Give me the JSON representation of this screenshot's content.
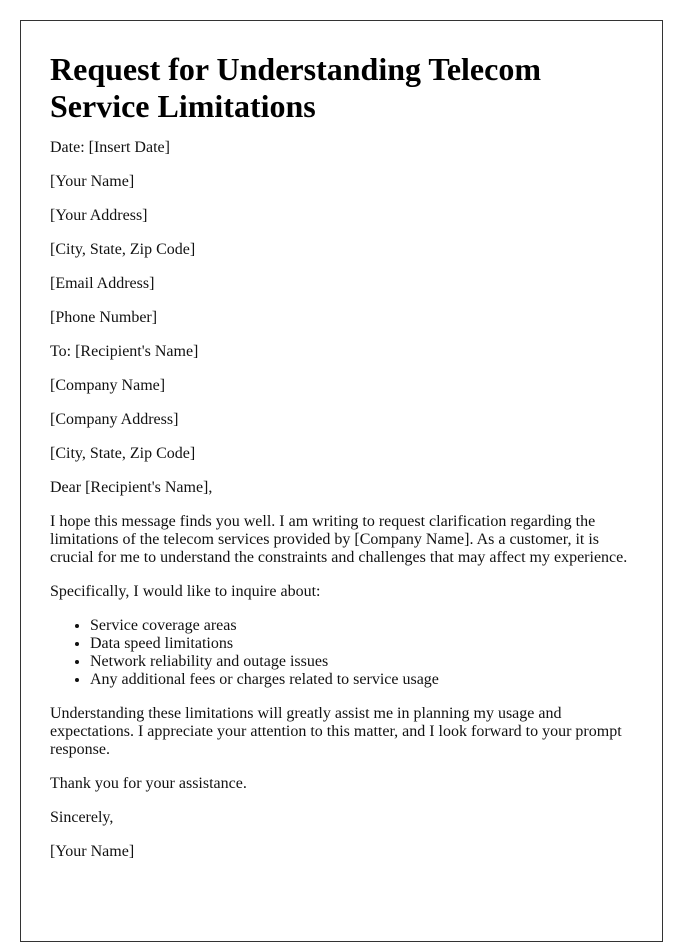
{
  "letter": {
    "title": "Request for Understanding Telecom Service Limitations",
    "date_line": "Date: [Insert Date]",
    "sender": {
      "name": "[Your Name]",
      "address": "[Your Address]",
      "city_state_zip": "[City, State, Zip Code]",
      "email": "[Email Address]",
      "phone": "[Phone Number]"
    },
    "recipient": {
      "to_line": "To: [Recipient's Name]",
      "company": "[Company Name]",
      "company_address": "[Company Address]",
      "city_state_zip": "[City, State, Zip Code]"
    },
    "salutation": "Dear [Recipient's Name],",
    "body": {
      "intro": "I hope this message finds you well. I am writing to request clarification regarding the limitations of the telecom services provided by [Company Name]. As a customer, it is crucial for me to understand the constraints and challenges that may affect my experience.",
      "list_intro": "Specifically, I would like to inquire about:",
      "items": [
        "Service coverage areas",
        "Data speed limitations",
        "Network reliability and outage issues",
        "Any additional fees or charges related to service usage"
      ],
      "closing_paragraph": "Understanding these limitations will greatly assist me in planning my usage and expectations. I appreciate your attention to this matter, and I look forward to your prompt response.",
      "thanks": "Thank you for your assistance."
    },
    "signoff": "Sincerely,",
    "signature": "[Your Name]"
  }
}
